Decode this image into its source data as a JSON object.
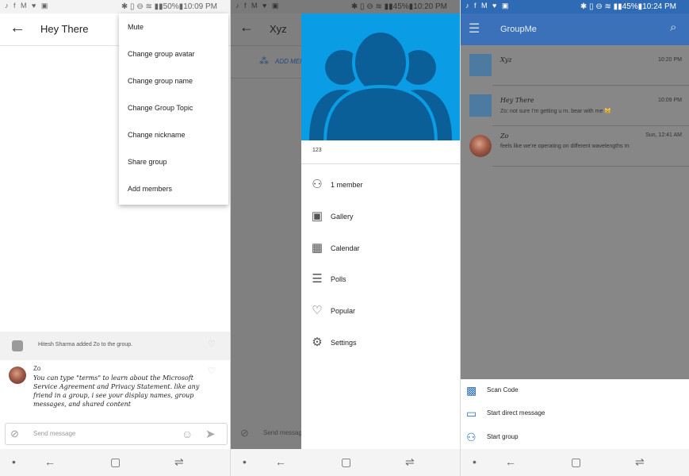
{
  "status_bars": [
    {
      "time": "10:09 PM",
      "battery": "50%",
      "left_icons": "♪ f M ♥ ▣"
    },
    {
      "time": "10:20 PM",
      "battery": "45%",
      "left_icons": "♪ f M ♥ ▣"
    },
    {
      "time": "10:24 PM",
      "battery": "45%",
      "left_icons": "♪ f M ♥ ▣"
    }
  ],
  "chat_screen": {
    "title": "Hey There",
    "menu_items": [
      "Mute",
      "Change group avatar",
      "Change group name",
      "Change Group Topic",
      "Change nickname",
      "Share group",
      "Add members"
    ],
    "system_message": "Hitesh Sharma added Zo to the group.",
    "message": {
      "author": "Zo",
      "body": "You can type \"terms\" to learn about the Microsoft Service Agreement and Privacy Statement. like any friend in a group, i see your display names, group messages, and shared content"
    },
    "composer_placeholder": "Send message"
  },
  "drawer_screen": {
    "title": "Xyz",
    "add_members_label": "ADD MEMBERS",
    "group_name": "123",
    "composer_placeholder": "Send message",
    "items": [
      {
        "label": "1 member",
        "icon": "people-icon"
      },
      {
        "label": "Gallery",
        "icon": "image-icon"
      },
      {
        "label": "Calendar",
        "icon": "calendar-icon"
      },
      {
        "label": "Polls",
        "icon": "list-icon"
      },
      {
        "label": "Popular",
        "icon": "heart-icon"
      },
      {
        "label": "Settings",
        "icon": "gear-icon"
      }
    ]
  },
  "list_screen": {
    "app_title": "GroupMe",
    "chats": [
      {
        "name": "Xyz",
        "time": "10:20 PM",
        "preview": ""
      },
      {
        "name": "Hey There",
        "time": "10:09 PM",
        "preview": "Zo: not sure I'm getting u rn. bear with me 😸"
      },
      {
        "name": "Zo",
        "time": "Sun, 12:41 AM",
        "preview": "feels like we're operating on different wavelengths rn"
      }
    ],
    "actions": [
      {
        "label": "Scan Code",
        "icon": "qr-icon"
      },
      {
        "label": "Start direct message",
        "icon": "message-icon"
      },
      {
        "label": "Start group",
        "icon": "group-icon"
      }
    ]
  },
  "colors": {
    "accent_blue": "#3a71b8",
    "hero_blue": "#0a9de5"
  }
}
